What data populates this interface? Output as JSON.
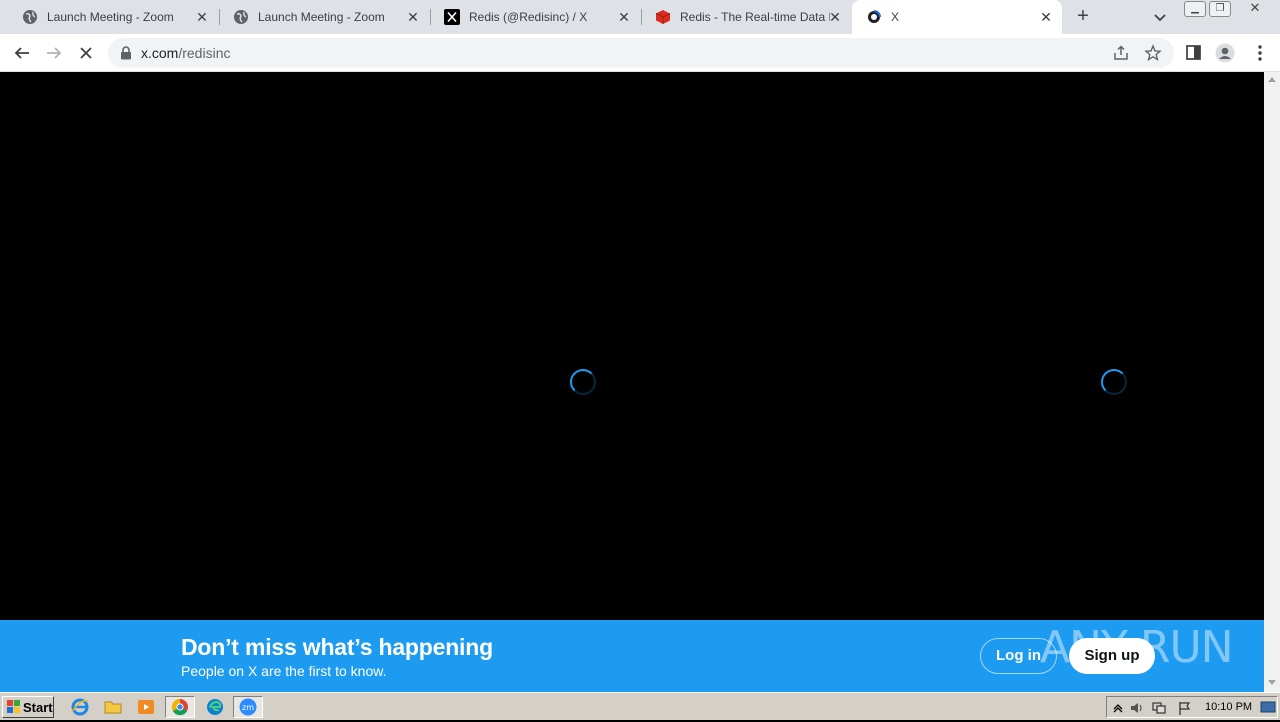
{
  "tabs": [
    {
      "title": "Launch Meeting - Zoom",
      "icon": "globe-icon"
    },
    {
      "title": "Launch Meeting - Zoom",
      "icon": "globe-icon"
    },
    {
      "title": "Redis (@Redisinc) / X",
      "icon": "x-logo-icon"
    },
    {
      "title": "Redis - The Real-time Data Pla",
      "icon": "redis-logo-icon"
    },
    {
      "title": "X",
      "icon": "loading-favicon-icon"
    }
  ],
  "address_bar": {
    "host": "x.com",
    "path": "/redisinc"
  },
  "banner": {
    "headline": "Don’t miss what’s happening",
    "subtext": "People on X are the first to know.",
    "login_label": "Log in",
    "signup_label": "Sign up",
    "watermark": "ANY RUN"
  },
  "taskbar": {
    "start_label": "Start",
    "clock": "10:10 PM"
  },
  "colors": {
    "x_blue": "#1d9bf0",
    "page_bg": "#000000",
    "taskbar": "#d4d0c8"
  }
}
